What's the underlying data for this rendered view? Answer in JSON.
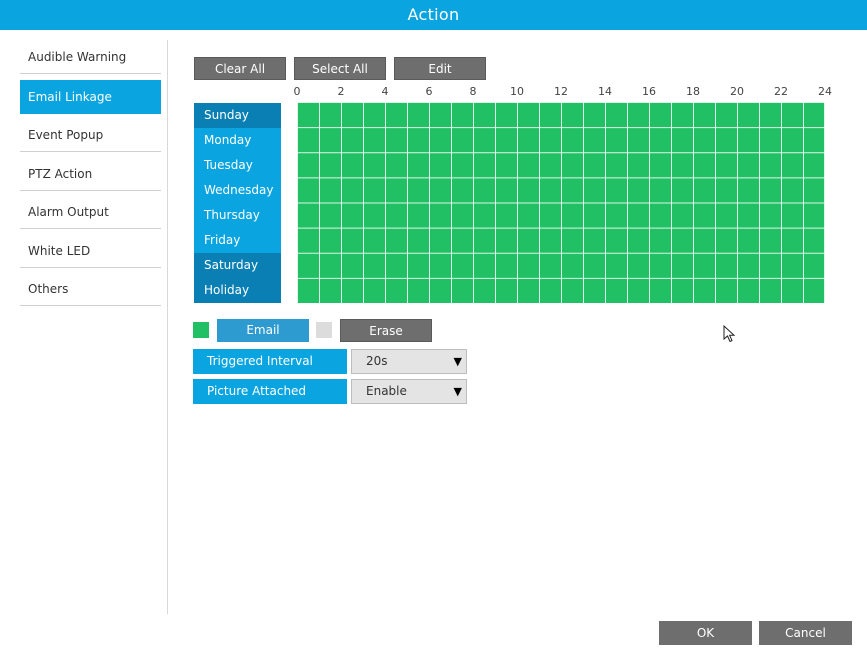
{
  "window": {
    "title": "Action"
  },
  "sidebar": {
    "items": [
      {
        "label": "Audible Warning",
        "active": false
      },
      {
        "label": "Email Linkage",
        "active": true
      },
      {
        "label": "Event Popup",
        "active": false
      },
      {
        "label": "PTZ Action",
        "active": false
      },
      {
        "label": "Alarm Output",
        "active": false
      },
      {
        "label": "White LED",
        "active": false
      },
      {
        "label": "Others",
        "active": false
      }
    ]
  },
  "toolbar": {
    "clear_all": "Clear All",
    "select_all": "Select All",
    "edit": "Edit"
  },
  "schedule": {
    "hours": [
      "0",
      "2",
      "4",
      "6",
      "8",
      "10",
      "12",
      "14",
      "16",
      "18",
      "20",
      "22",
      "24"
    ],
    "days": [
      "Sunday",
      "Monday",
      "Tuesday",
      "Wednesday",
      "Thursday",
      "Friday",
      "Saturday",
      "Holiday"
    ],
    "all_selected": true
  },
  "legend": {
    "email_label": "Email",
    "erase_label": "Erase",
    "email_color": "#21c065",
    "erase_color": "#dcdcdc"
  },
  "fields": {
    "triggered_interval": {
      "label": "Triggered Interval",
      "value": "20s"
    },
    "picture_attached": {
      "label": "Picture Attached",
      "value": "Enable"
    }
  },
  "footer": {
    "ok": "OK",
    "cancel": "Cancel"
  },
  "colors": {
    "accent": "#0aa5e0",
    "selected_cell": "#21c065",
    "button_gray": "#6e6e6e"
  }
}
